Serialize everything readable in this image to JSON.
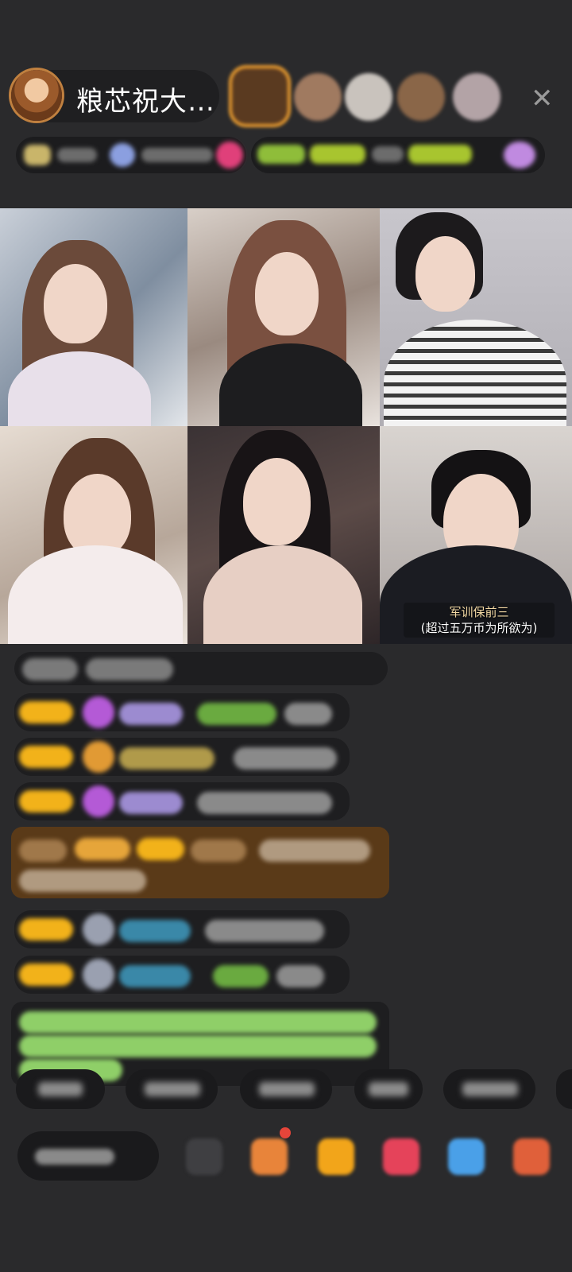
{
  "header": {
    "host_name": "粮芯祝大…",
    "close_icon": "close-icon",
    "guests_count_visible": 5
  },
  "video_grid": {
    "tiles": [
      {
        "label": ""
      },
      {
        "label": ""
      },
      {
        "label": ""
      },
      {
        "label": ""
      },
      {
        "label": ""
      },
      {
        "caption_line1": "军训保前三",
        "caption_line2": "(超过五万币为所欲为)"
      }
    ]
  },
  "colors": {
    "background": "#2a2a2c",
    "badge_gold": "#f2b21a",
    "chat_brown": "#5a3a18",
    "system_text_green": "#8fcf68",
    "notification": "#e6453a"
  }
}
